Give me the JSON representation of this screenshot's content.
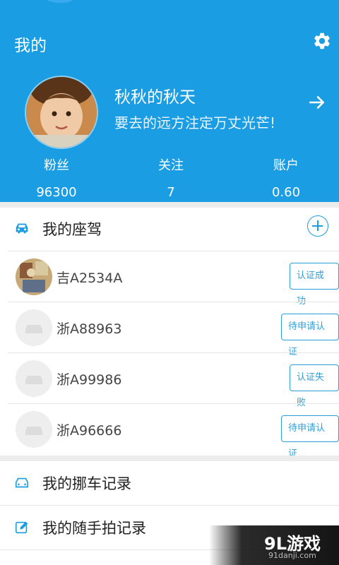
{
  "header": {
    "title": "我的",
    "username": "秋秋的秋天",
    "motto": "要去的远方注定万丈光芒!",
    "stats": [
      {
        "label": "粉丝",
        "value": "96300"
      },
      {
        "label": "关注",
        "value": "7"
      },
      {
        "label": "账户",
        "value": "0.60"
      }
    ]
  },
  "vehicles": {
    "title": "我的座驾",
    "items": [
      {
        "plate": "吉A2534A",
        "status": "认证成功"
      },
      {
        "plate": "浙A88963",
        "status": "待申请认证"
      },
      {
        "plate": "浙A99986",
        "status": "认证失败"
      },
      {
        "plate": "浙A96666",
        "status": "待申请认证"
      }
    ]
  },
  "menu": [
    {
      "label": "我的挪车记录",
      "icon": "car-outline-icon"
    },
    {
      "label": "我的随手拍记录",
      "icon": "edit-icon"
    }
  ],
  "watermark": {
    "logo": "9L游戏",
    "site": "91danji.com"
  },
  "colors": {
    "primary": "#1a9de2",
    "button_border": "#2a9fd8"
  }
}
